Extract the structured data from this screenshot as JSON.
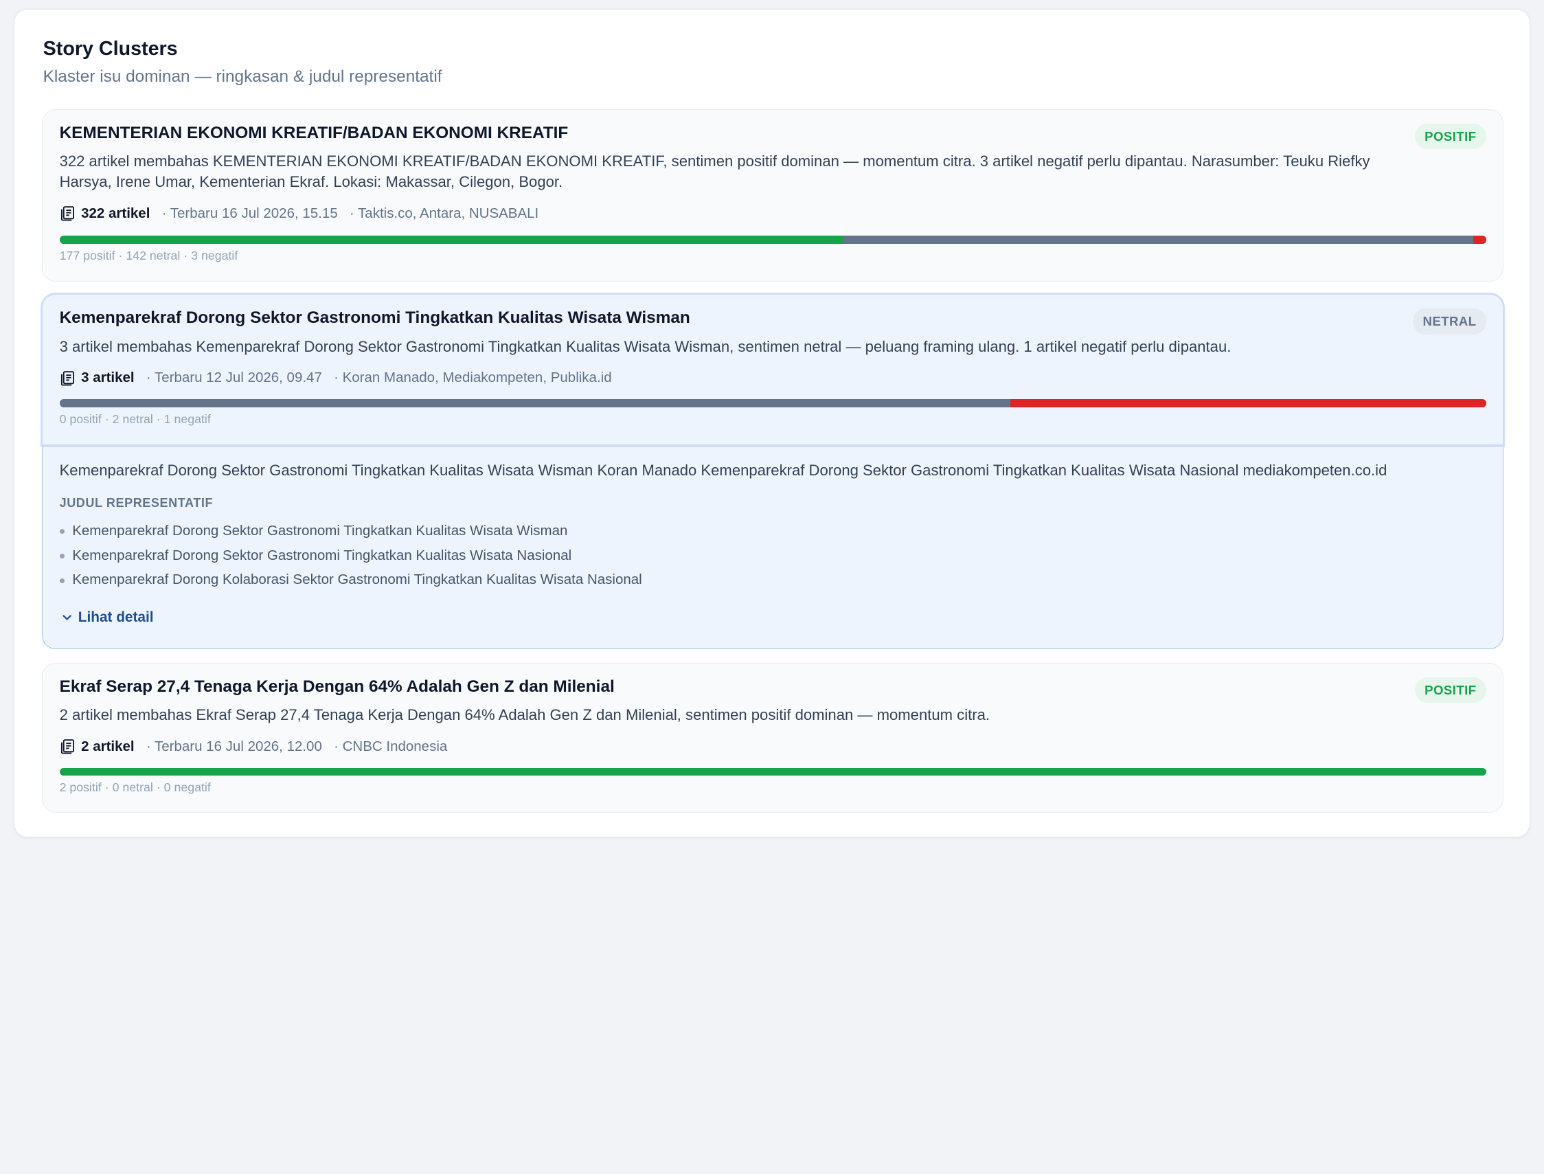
{
  "panel": {
    "title": "Story Clusters",
    "subtitle": "Klaster isu dominan — ringkasan & judul representatif"
  },
  "colors": {
    "positive": "#16a34a",
    "neutral": "#64748b",
    "negative": "#dc2626",
    "link": "#1d4f91"
  },
  "clusters": [
    {
      "title": "KEMENTERIAN EKONOMI KREATIF/BADAN EKONOMI KREATIF",
      "sentiment": "POSITIF",
      "summary": "322 artikel membahas KEMENTERIAN EKONOMI KREATIF/BADAN EKONOMI KREATIF, sentimen positif dominan — momentum citra. 3 artikel negatif perlu dipantau. Narasumber: Teuku Riefky Harsya, Irene Umar, Kementerian Ekraf. Lokasi: Makassar, Cilegon, Bogor.",
      "count_label": "322 artikel",
      "latest": "· Terbaru 16 Jul 2026, 15.15",
      "sources": "· Taktis.co, Antara, NUSABALI",
      "positive": 177,
      "neutral": 142,
      "negative": 3,
      "caption": "177 positif · 142 netral · 3 negatif"
    },
    {
      "title": "Kemenparekraf Dorong Sektor Gastronomi Tingkatkan Kualitas Wisata Wisman",
      "sentiment": "NETRAL",
      "summary": "3 artikel membahas Kemenparekraf Dorong Sektor Gastronomi Tingkatkan Kualitas Wisata Wisman, sentimen netral — peluang framing ulang. 1 artikel negatif perlu dipantau.",
      "count_label": "3 artikel",
      "latest": "· Terbaru 12 Jul 2026, 09.47",
      "sources": "· Koran Manado, Mediakompeten, Publika.id",
      "positive": 0,
      "neutral": 2,
      "negative": 1,
      "caption": "0 positif · 2 netral · 1 negatif",
      "expanded": true,
      "detail_text": "Kemenparekraf Dorong Sektor Gastronomi Tingkatkan Kualitas Wisata Wisman Koran Manado Kemenparekraf Dorong Sektor Gastronomi Tingkatkan Kualitas Wisata Nasional mediakompeten.co.id",
      "rep_label": "JUDUL REPRESENTATIF",
      "rep_titles": [
        "Kemenparekraf Dorong Sektor Gastronomi Tingkatkan Kualitas Wisata Wisman",
        "Kemenparekraf Dorong Sektor Gastronomi Tingkatkan Kualitas Wisata Nasional",
        "Kemenparekraf Dorong Kolaborasi Sektor Gastronomi Tingkatkan Kualitas Wisata Nasional"
      ],
      "detail_link": "Lihat detail"
    },
    {
      "title": "Ekraf Serap 27,4 Tenaga Kerja Dengan 64% Adalah Gen Z dan Milenial",
      "sentiment": "POSITIF",
      "summary": "2 artikel membahas Ekraf Serap 27,4 Tenaga Kerja Dengan 64% Adalah Gen Z dan Milenial, sentimen positif dominan — momentum citra.",
      "count_label": "2 artikel",
      "latest": "· Terbaru 16 Jul 2026, 12.00",
      "sources": "· CNBC Indonesia",
      "positive": 2,
      "neutral": 0,
      "negative": 0,
      "caption": "2 positif · 0 netral · 0 negatif"
    }
  ]
}
